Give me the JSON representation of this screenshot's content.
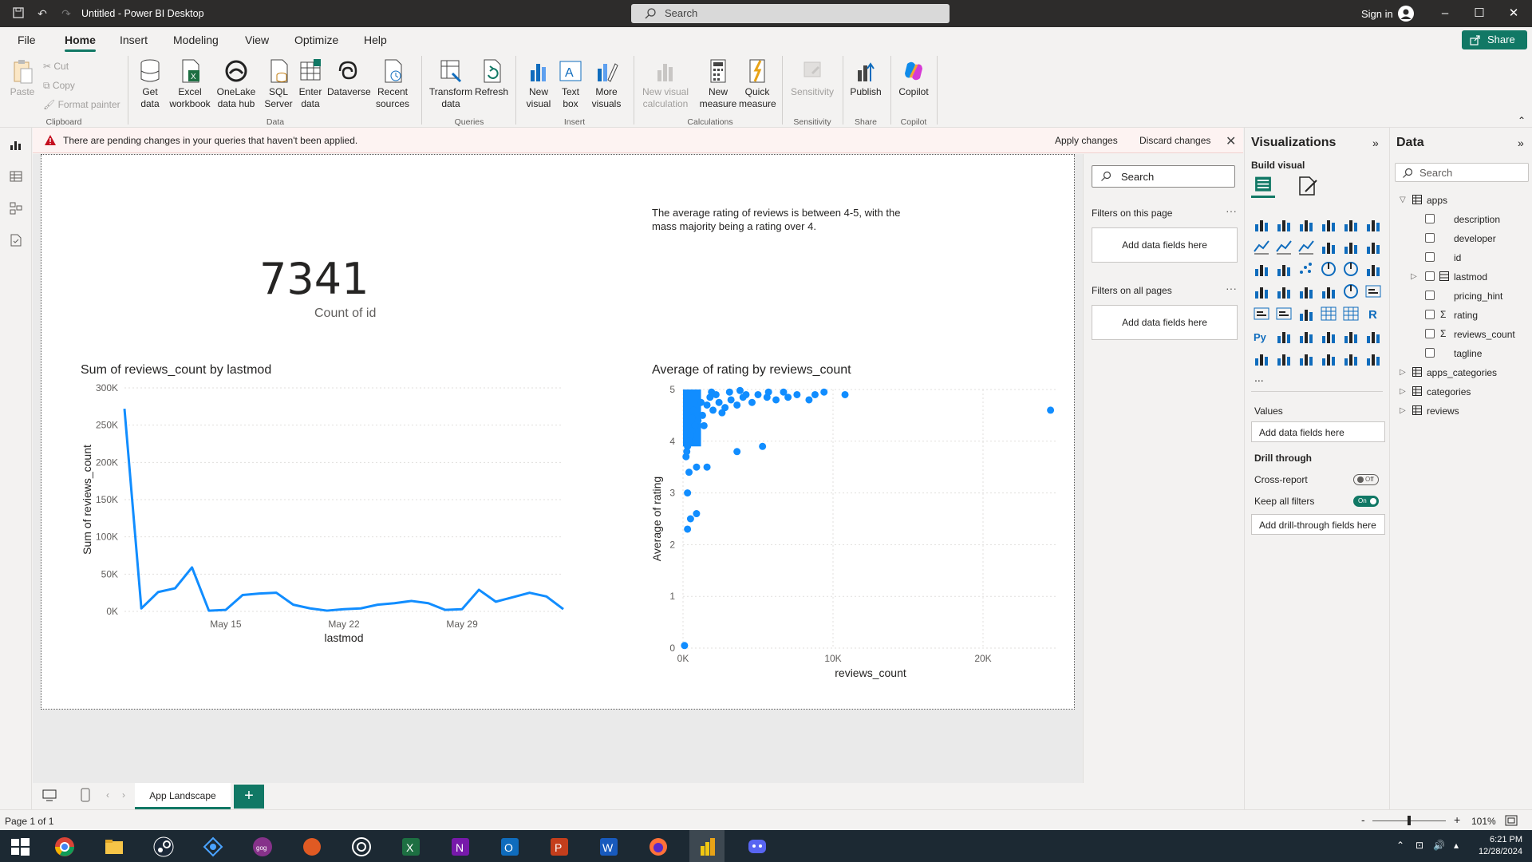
{
  "window": {
    "title": "Untitled - Power BI Desktop",
    "search_placeholder": "Search",
    "signin": "Sign in"
  },
  "menu": {
    "tabs": [
      "File",
      "Home",
      "Insert",
      "Modeling",
      "View",
      "Optimize",
      "Help"
    ],
    "active": "Home",
    "share": "Share"
  },
  "ribbon": {
    "clipboard": {
      "paste": "Paste",
      "cut": "Cut",
      "copy": "Copy",
      "format_painter": "Format painter",
      "label": "Clipboard"
    },
    "data": {
      "get_data": "Get data",
      "excel": "Excel workbook",
      "onelake": "OneLake data hub",
      "sql": "SQL Server",
      "enter": "Enter data",
      "dataverse": "Dataverse",
      "recent": "Recent sources",
      "label": "Data"
    },
    "queries": {
      "transform": "Transform data",
      "refresh": "Refresh",
      "label": "Queries"
    },
    "insert": {
      "new_visual": "New visual",
      "text_box": "Text box",
      "more_visuals": "More visuals",
      "label": "Insert"
    },
    "calculations": {
      "new_visual_calc": "New visual calculation",
      "new_measure": "New measure",
      "quick_measure": "Quick measure",
      "label": "Calculations"
    },
    "sensitivity": {
      "sensitivity": "Sensitivity",
      "label": "Sensitivity"
    },
    "share": {
      "publish": "Publish",
      "label": "Share"
    },
    "copilot": {
      "copilot": "Copilot",
      "label": "Copilot"
    }
  },
  "warning": {
    "message": "There are pending changes in your queries that haven't been applied.",
    "apply": "Apply changes",
    "discard": "Discard changes"
  },
  "canvas": {
    "card": {
      "value": "7341",
      "label": "Count of id"
    },
    "textbox": "The average rating of reviews is between 4-5, with the mass majority being a rating over 4.",
    "line_title": "Sum of reviews_count by lastmod",
    "scatter_title": "Average of rating by reviews_count"
  },
  "chart_data": [
    {
      "type": "line",
      "title": "Sum of reviews_count by lastmod",
      "xlabel": "lastmod",
      "ylabel": "Sum of reviews_count",
      "x_tick_labels": [
        "May 15",
        "May 22",
        "May 29"
      ],
      "y_tick_labels": [
        "0K",
        "50K",
        "100K",
        "150K",
        "200K",
        "250K",
        "300K"
      ],
      "ylim": [
        0,
        300000
      ],
      "grid": true,
      "series": [
        {
          "color": "#118dff",
          "values": [
            272000,
            4000,
            26000,
            31000,
            59000,
            1000,
            2000,
            22000,
            24000,
            25000,
            9000,
            4000,
            1000,
            3000,
            4000,
            9000,
            11000,
            14000,
            11000,
            2000,
            3000,
            29000,
            13000,
            19000,
            25000,
            20000,
            3000
          ]
        }
      ]
    },
    {
      "type": "scatter",
      "title": "Average of rating by reviews_count",
      "xlabel": "reviews_count",
      "ylabel": "Average of rating",
      "x_tick_labels": [
        "0K",
        "10K",
        "20K"
      ],
      "y_tick_labels": [
        "0",
        "1",
        "2",
        "3",
        "4",
        "5"
      ],
      "xlim": [
        0,
        25000
      ],
      "ylim": [
        0,
        5
      ],
      "grid": true,
      "color": "#118dff",
      "points": [
        [
          24500,
          4.6
        ],
        [
          10800,
          4.9
        ],
        [
          9400,
          4.95
        ],
        [
          8800,
          4.9
        ],
        [
          8400,
          4.8
        ],
        [
          7600,
          4.9
        ],
        [
          7000,
          4.85
        ],
        [
          6200,
          4.8
        ],
        [
          5600,
          4.85
        ],
        [
          5000,
          4.9
        ],
        [
          4600,
          4.75
        ],
        [
          4000,
          4.85
        ],
        [
          3600,
          4.7
        ],
        [
          3200,
          4.8
        ],
        [
          2800,
          4.65
        ],
        [
          2400,
          4.75
        ],
        [
          2000,
          4.6
        ],
        [
          1600,
          4.7
        ],
        [
          1300,
          4.5
        ],
        [
          1000,
          4.4
        ],
        [
          800,
          4.3
        ],
        [
          600,
          4.2
        ],
        [
          500,
          4.1
        ],
        [
          400,
          4.0
        ],
        [
          300,
          3.9
        ],
        [
          250,
          3.8
        ],
        [
          200,
          3.7
        ],
        [
          5300,
          3.9
        ],
        [
          3600,
          3.8
        ],
        [
          1600,
          3.5
        ],
        [
          900,
          3.5
        ],
        [
          400,
          3.4
        ],
        [
          300,
          3.0
        ],
        [
          900,
          2.6
        ],
        [
          500,
          2.5
        ],
        [
          300,
          2.3
        ],
        [
          100,
          0.05
        ],
        [
          4200,
          4.9
        ],
        [
          3100,
          4.95
        ],
        [
          2200,
          4.9
        ],
        [
          1800,
          4.85
        ],
        [
          1200,
          4.75
        ],
        [
          700,
          4.6
        ],
        [
          2600,
          4.55
        ],
        [
          1400,
          4.3
        ],
        [
          600,
          4.45
        ],
        [
          1900,
          4.95
        ],
        [
          3800,
          4.98
        ],
        [
          5700,
          4.95
        ],
        [
          6700,
          4.95
        ]
      ]
    }
  ],
  "filters": {
    "search": "Search",
    "on_this_page": "Filters on this page",
    "on_all_pages": "Filters on all pages",
    "add_fields": "Add data fields here"
  },
  "viz_pane": {
    "title": "Visualizations",
    "build_visual": "Build visual",
    "values": "Values",
    "values_drop": "Add data fields here",
    "drill_through": "Drill through",
    "cross_report": "Cross-report",
    "cross_report_state": "Off",
    "keep_all_filters": "Keep all filters",
    "keep_state": "On",
    "drill_drop": "Add drill-through fields here",
    "more": "..."
  },
  "data_pane": {
    "title": "Data",
    "search": "Search",
    "tables": [
      {
        "name": "apps",
        "expanded": true,
        "fields": [
          {
            "name": "description",
            "sigma": false
          },
          {
            "name": "developer",
            "sigma": false
          },
          {
            "name": "id",
            "sigma": false
          },
          {
            "name": "lastmod",
            "sigma": false,
            "table_icon": true
          },
          {
            "name": "pricing_hint",
            "sigma": false
          },
          {
            "name": "rating",
            "sigma": true
          },
          {
            "name": "reviews_count",
            "sigma": true
          },
          {
            "name": "tagline",
            "sigma": false
          }
        ]
      },
      {
        "name": "apps_categories",
        "expanded": false
      },
      {
        "name": "categories",
        "expanded": false
      },
      {
        "name": "reviews",
        "expanded": false
      }
    ]
  },
  "page_tabs": {
    "active": "App Landscape",
    "add": "+"
  },
  "status": {
    "page": "Page 1 of 1",
    "zoom": "101%"
  },
  "taskbar": {
    "time": "6:21 PM",
    "date": "12/28/2024"
  },
  "colors": {
    "accent": "#117865",
    "series": "#118dff",
    "warning": "#c50f1f"
  }
}
